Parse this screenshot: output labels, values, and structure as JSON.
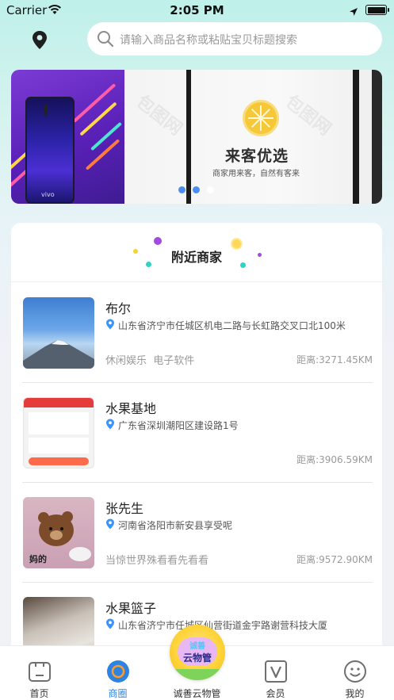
{
  "status_bar": {
    "carrier": "Carrier",
    "time": "2:05 PM"
  },
  "search": {
    "placeholder": "请输入商品名称或粘贴宝贝标题搜索"
  },
  "banner": {
    "brand": "vivo",
    "title": "来客优选",
    "subtitle": "商家用来客，自然有客来",
    "watermark": "包图网",
    "slide_count": 3,
    "active_slide": 3
  },
  "nearby": {
    "title": "附近商家",
    "shops": [
      {
        "name": "布尔",
        "address": "山东省济宁市任城区机电二路与长虹路交叉口北100米",
        "tags": "休闲娱乐  电子软件",
        "distance": "距离:3271.45KM"
      },
      {
        "name": "水果基地",
        "address": "广东省深圳潮阳区建设路1号",
        "tags": "",
        "distance": "距离:3906.59KM"
      },
      {
        "name": "张先生",
        "address": "河南省洛阳市新安县享受呢",
        "tags": "当惊世界殊看看先看看",
        "distance": "距离:9572.90KM",
        "image_caption": "妈的"
      },
      {
        "name": "水果篮子",
        "address": "山东省济宁市任城区仙营街道金宇路谢营科技大厦",
        "tags": "",
        "distance": ""
      }
    ]
  },
  "tabbar": {
    "tabs": [
      {
        "label": "首页",
        "icon": "home-icon"
      },
      {
        "label": "商圈",
        "icon": "circle-icon"
      },
      {
        "label": "诚善云物管",
        "icon": "cloud-logo-icon"
      },
      {
        "label": "会员",
        "icon": "vip-icon"
      },
      {
        "label": "我的",
        "icon": "smile-icon"
      }
    ],
    "active": "商圈",
    "center_badge": {
      "line1": "诚善",
      "line2": "云物管"
    }
  },
  "colors": {
    "accent": "#2e83e0",
    "badge": "#ffd43a",
    "pin": "#3b93ff"
  }
}
